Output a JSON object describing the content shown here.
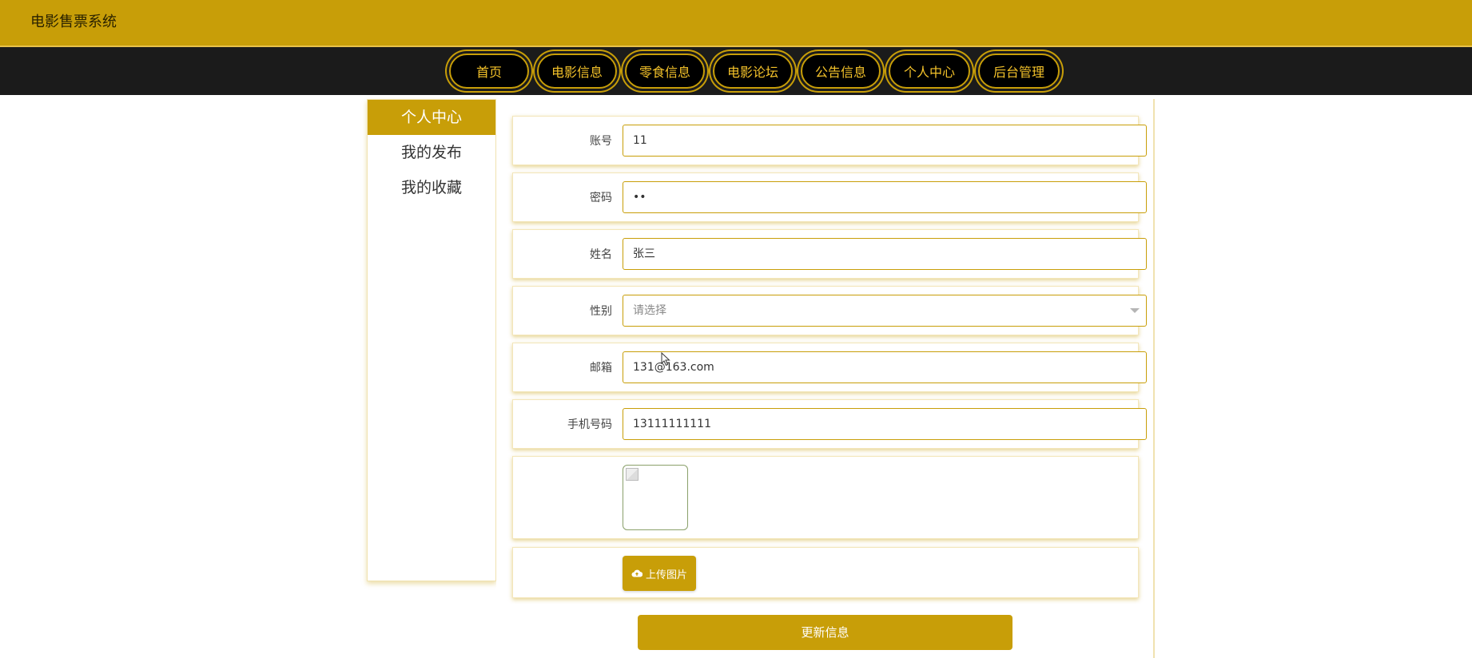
{
  "header": {
    "site_title": "电影售票系统"
  },
  "nav": {
    "items": [
      {
        "label": "首页"
      },
      {
        "label": "电影信息"
      },
      {
        "label": "零食信息"
      },
      {
        "label": "电影论坛"
      },
      {
        "label": "公告信息"
      },
      {
        "label": "个人中心"
      },
      {
        "label": "后台管理"
      }
    ]
  },
  "sidebar": {
    "items": [
      {
        "label": "个人中心"
      },
      {
        "label": "我的发布"
      },
      {
        "label": "我的收藏"
      }
    ]
  },
  "form": {
    "account": {
      "label": "账号",
      "value": "11"
    },
    "password": {
      "label": "密码",
      "value": "••"
    },
    "name": {
      "label": "姓名",
      "value": "张三"
    },
    "gender": {
      "label": "性别",
      "placeholder": "请选择"
    },
    "email": {
      "label": "邮箱",
      "value": "131@163.com"
    },
    "phone": {
      "label": "手机号码",
      "value": "13111111111"
    },
    "upload_label": "上传图片",
    "submit_label": "更新信息"
  },
  "colors": {
    "accent": "#c89e08",
    "nav_bg": "#1b1b1b",
    "nav_text": "#f4c22a"
  },
  "icons": {
    "upload": "cloud-upload-icon",
    "select_arrow": "chevron-down-icon"
  }
}
